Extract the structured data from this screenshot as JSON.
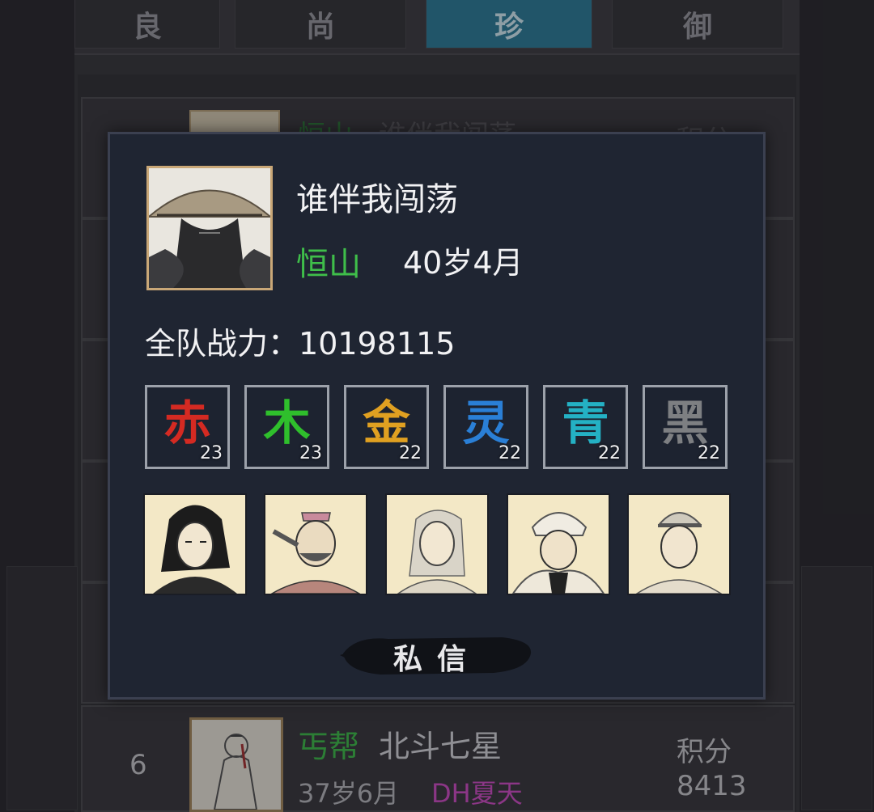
{
  "tabs": [
    {
      "label": "良"
    },
    {
      "label": "尚"
    },
    {
      "label": "珍"
    },
    {
      "label": "御"
    }
  ],
  "active_tab": "珍",
  "background_list": {
    "row_top": {
      "sect": "恒山",
      "name": "谁伴我闯荡",
      "score_label": "积分"
    },
    "row_bottom": {
      "rank": "6",
      "sect": "丐帮",
      "name": "北斗七星",
      "age": "37岁6月",
      "guild_tag": "DH夏天",
      "score_label": "积分",
      "score": "8413"
    }
  },
  "popup": {
    "player_name": "谁伴我闯荡",
    "sect": "恒山",
    "age": "40岁4月",
    "power_label": "全队战力：",
    "power_value": "10198115",
    "elements": [
      {
        "char": "赤",
        "level": "23",
        "color": "#d42a22"
      },
      {
        "char": "木",
        "level": "23",
        "color": "#2fbf2c"
      },
      {
        "char": "金",
        "level": "22",
        "color": "#e0a021"
      },
      {
        "char": "灵",
        "level": "22",
        "color": "#2a7fd6"
      },
      {
        "char": "青",
        "level": "22",
        "color": "#24b1c4"
      },
      {
        "char": "黑",
        "level": "22",
        "color": "#7d7f82"
      }
    ],
    "heroes": [
      "hero-portrait-1",
      "hero-portrait-2",
      "hero-portrait-3",
      "hero-portrait-4",
      "hero-portrait-5"
    ],
    "message_button": "私信"
  },
  "colors": {
    "sect_green": "#3fbe4a",
    "tab_active": "#2e7f9a",
    "popup_bg": "#1f2532",
    "guild_tag": "#d24fc7"
  }
}
